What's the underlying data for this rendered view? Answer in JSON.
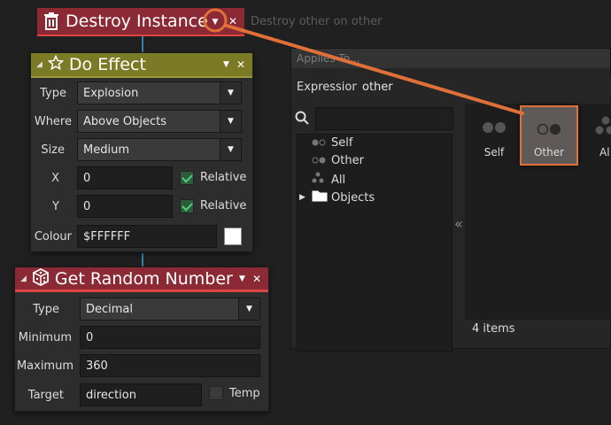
{
  "destroy_block": {
    "title": "Destroy Instance",
    "description": "Destroy other on other"
  },
  "effect_block": {
    "title": "Do Effect",
    "type_label": "Type",
    "type_value": "Explosion",
    "where_label": "Where",
    "where_value": "Above Objects",
    "size_label": "Size",
    "size_value": "Medium",
    "x_label": "X",
    "x_value": "0",
    "x_relative_label": "Relative",
    "y_label": "Y",
    "y_value": "0",
    "y_relative_label": "Relative",
    "colour_label": "Colour",
    "colour_value": "$FFFFFF",
    "swatch_color": "#FFFFFF"
  },
  "random_block": {
    "title": "Get Random Number",
    "type_label": "Type",
    "type_value": "Decimal",
    "min_label": "Minimum",
    "min_value": "0",
    "max_label": "Maximum",
    "max_value": "360",
    "target_label": "Target",
    "target_value": "direction",
    "temp_label": "Temp"
  },
  "applies_panel": {
    "title": "Applies To...",
    "expression_label": "Expression",
    "expression_value": "other",
    "search_value": "",
    "tree_items": [
      "Self",
      "Other",
      "All",
      "Objects"
    ],
    "tiles": [
      "Self",
      "Other",
      "Al"
    ],
    "collapse_glyph": "«",
    "item_count": "4 items"
  },
  "colors": {
    "highlight": "#e07038",
    "red_header": "#8b2a34",
    "olive_header": "#7b7a25",
    "check_green": "#4fd07a"
  }
}
